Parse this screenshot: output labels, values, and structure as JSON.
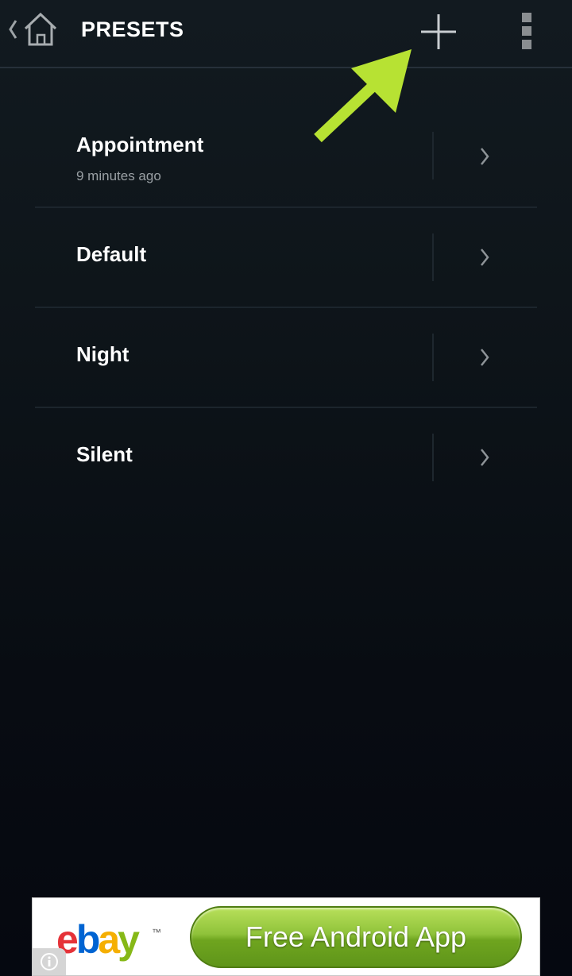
{
  "action_bar": {
    "title": "PRESETS",
    "icons": {
      "up": "chevron-left-icon",
      "home": "home-icon",
      "add": "plus-icon",
      "overflow": "more-vert-icon"
    }
  },
  "annotation": {
    "color": "#b7e233",
    "points_to": "add-preset-button"
  },
  "presets": [
    {
      "name": "Appointment",
      "subtitle": "9 minutes ago"
    },
    {
      "name": "Default",
      "subtitle": ""
    },
    {
      "name": "Night",
      "subtitle": ""
    },
    {
      "name": "Silent",
      "subtitle": ""
    }
  ],
  "ad": {
    "brand": {
      "e": "e",
      "b": "b",
      "a": "a",
      "y": "y",
      "tm": "™"
    },
    "brand_colors": [
      "#e53238",
      "#0064d2",
      "#f5af02",
      "#86b817"
    ],
    "cta_label": "Free Android App",
    "cta_color": "#8fc23a",
    "info_icon": "info-icon"
  }
}
